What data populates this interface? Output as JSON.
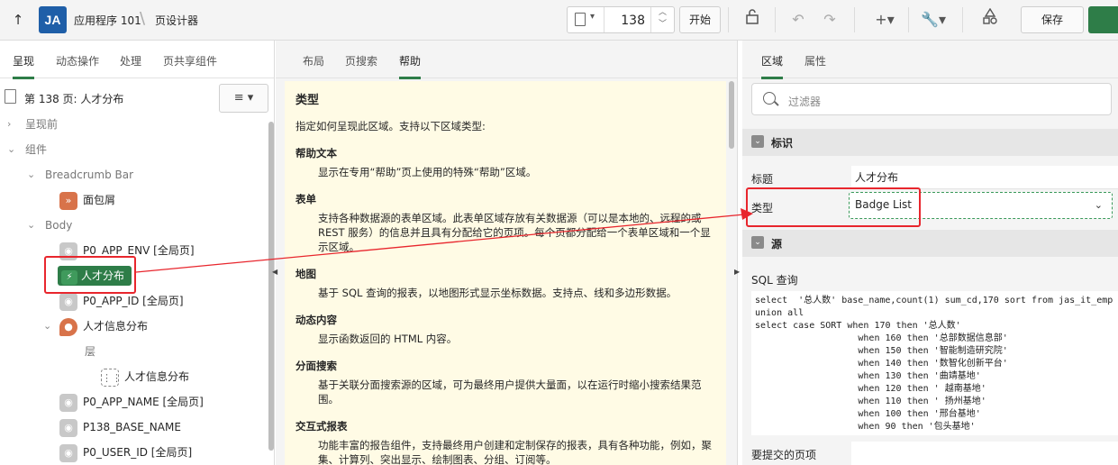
{
  "topbar": {
    "logo": "JA",
    "app_name": "应用程序 101",
    "separator": "\\",
    "designer": "页设计器",
    "page_number": "138",
    "go_label": "开始",
    "save_label": "保存"
  },
  "left": {
    "tabs": [
      "呈现",
      "动态操作",
      "处理",
      "页共享组件"
    ],
    "page_header": "第 138 页: 人才分布",
    "menu_icon": "≡",
    "tree": {
      "before_render": "呈现前",
      "components": "组件",
      "breadcrumb_bar": "Breadcrumb Bar",
      "breadcrumb": "面包屑",
      "body": "Body",
      "n_app_env": "P0_APP_ENV [全局页]",
      "selected": "人才分布",
      "n_app_id": "P0_APP_ID [全局页]",
      "talent_map": "人才信息分布",
      "layers": "层",
      "layer_item": "人才信息分布",
      "n_app_name": "P0_APP_NAME [全局页]",
      "n_base_name": "P138_BASE_NAME",
      "n_user_id": "P0_USER_ID [全局页]"
    }
  },
  "mid": {
    "tabs": [
      "布局",
      "页搜索",
      "帮助"
    ],
    "help": {
      "title": "类型",
      "intro": "指定如何呈现此区域。支持以下区域类型:",
      "items": [
        {
          "term": "帮助文本",
          "desc": "显示在专用“帮助”页上使用的特殊“帮助”区域。"
        },
        {
          "term": "表单",
          "desc": "支持各种数据源的表单区域。此表单区域存放有关数据源（可以是本地的、远程的或 REST 服务）的信息并且具有分配给它的页项。每个页都分配给一个表单区域和一个显示区域。"
        },
        {
          "term": "地图",
          "desc": "基于 SQL 查询的报表，以地图形式显示坐标数据。支持点、线和多边形数据。"
        },
        {
          "term": "动态内容",
          "desc": "显示函数返回的 HTML 内容。"
        },
        {
          "term": "分面搜索",
          "desc": "基于关联分面搜索源的区域，可为最终用户提供大量面，以在运行时缩小搜索结果范围。"
        },
        {
          "term": "交互式报表",
          "desc": "功能丰富的报告组件，支持最终用户创建和定制保存的报表，具有各种功能，例如，聚集、计算列、突出显示、绘制图表、分组、订阅等。"
        }
      ]
    }
  },
  "right": {
    "tabs": [
      "区域",
      "属性"
    ],
    "filter_placeholder": "过滤器",
    "section_identity": "标识",
    "title_label": "标题",
    "title_value": "人才分布",
    "type_label": "类型",
    "type_value": "Badge List",
    "section_source": "源",
    "sql_label": "SQL 查询",
    "sql_text": "select  '总人数' base_name,count(1) sum_cd,170 sort from jas_it_emp\nunion all\nselect case SORT when 170 then '总人数'\n                   when 160 then '总部数据信息部'\n                   when 150 then '智能制造研究院'\n                   when 140 then '数智化创新平台'\n                   when 130 then '曲靖基地'\n                   when 120 then ' 越南基地'\n                   when 110 then ' 扬州基地'\n                   when 100 then '邢台基地'\n                   when 90 then '包头基地'",
    "submit_label": "要提交的页项"
  },
  "colors": {
    "accent": "#2e7d48",
    "annotation": "#e8262d",
    "help_bg": "#fffbe5"
  }
}
